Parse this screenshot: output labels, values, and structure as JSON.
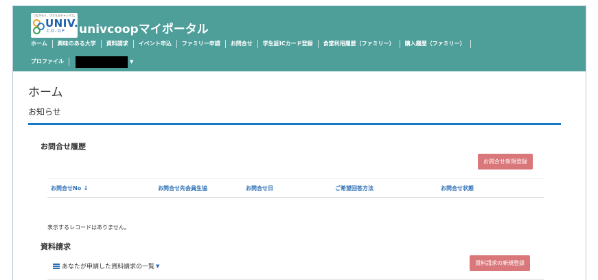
{
  "header": {
    "logo": {
      "tagline": "つながる人、ささえるキャンパス。",
      "brand": "UNIV.",
      "sub": "CO-OP"
    },
    "site_title": "univcoopマイポータル",
    "nav": [
      "ホーム",
      "興味のある大学",
      "資料請求",
      "イベント申込",
      "ファミリー申請",
      "お問合せ",
      "学生証ICカード登録",
      "食堂利用履歴（ファミリー）",
      "購入履歴（ファミリー）"
    ],
    "nav2": {
      "profile": "プロファイル"
    }
  },
  "main": {
    "page_title": "ホーム",
    "section_label": "お知らせ",
    "inquiry": {
      "title": "お問合せ履歴",
      "new_button": "お問合せ新規登録",
      "columns": [
        "お問合せNo",
        "お問合せ先会員生協",
        "お問合せ日",
        "ご希望回答方法",
        "お問合せ状態"
      ],
      "sort_indicator": "↓",
      "empty_message": "表示するレコードはありません。"
    },
    "materials": {
      "title": "資料請求",
      "list_toggle": "あなたが申請した資料請求の一覧",
      "new_button": "資料請求の新規登録"
    }
  },
  "colors": {
    "header_bg": "#4e9e9a",
    "accent_blue": "#1878c8",
    "button_pink": "#d9777a",
    "link_blue": "#2a6db5"
  }
}
